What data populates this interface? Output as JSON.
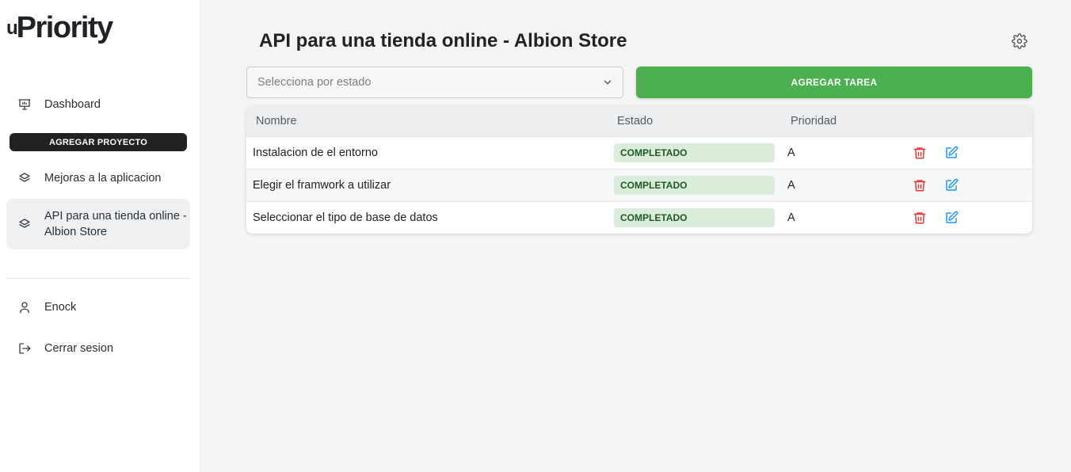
{
  "app": {
    "logo_mark": "u",
    "logo_text": "Priority"
  },
  "sidebar": {
    "dashboard_label": "Dashboard",
    "add_project_label": "AGREGAR PROYECTO",
    "projects": [
      {
        "label": "Mejoras a la aplicacion",
        "active": false
      },
      {
        "label": "API para una tienda online - Albion Store",
        "active": true
      }
    ],
    "user_label": "Enock",
    "logout_label": "Cerrar sesion"
  },
  "main": {
    "title": "API para una tienda online - Albion Store",
    "filter_placeholder": "Selecciona por estado",
    "add_task_label": "AGREGAR TAREA",
    "table": {
      "headers": [
        "Nombre",
        "Estado",
        "Prioridad"
      ],
      "rows": [
        {
          "name": "Instalacion de el entorno",
          "status": "COMPLETADO",
          "priority": "A"
        },
        {
          "name": "Elegir el framwork a utilizar",
          "status": "COMPLETADO",
          "priority": "A"
        },
        {
          "name": "Seleccionar el tipo de base de datos",
          "status": "COMPLETADO",
          "priority": "A"
        }
      ]
    }
  },
  "colors": {
    "accent_green": "#4caf50",
    "status_badge_bg": "#d9edda",
    "delete_red": "#e53935",
    "edit_blue": "#2196f3"
  },
  "icons": {
    "dashboard": "presentation-board-icon",
    "project": "layers-icon",
    "user": "user-icon",
    "logout": "logout-icon",
    "settings": "gear-icon",
    "dropdown": "chevron-down-icon",
    "delete": "trash-icon",
    "edit": "edit-icon"
  }
}
